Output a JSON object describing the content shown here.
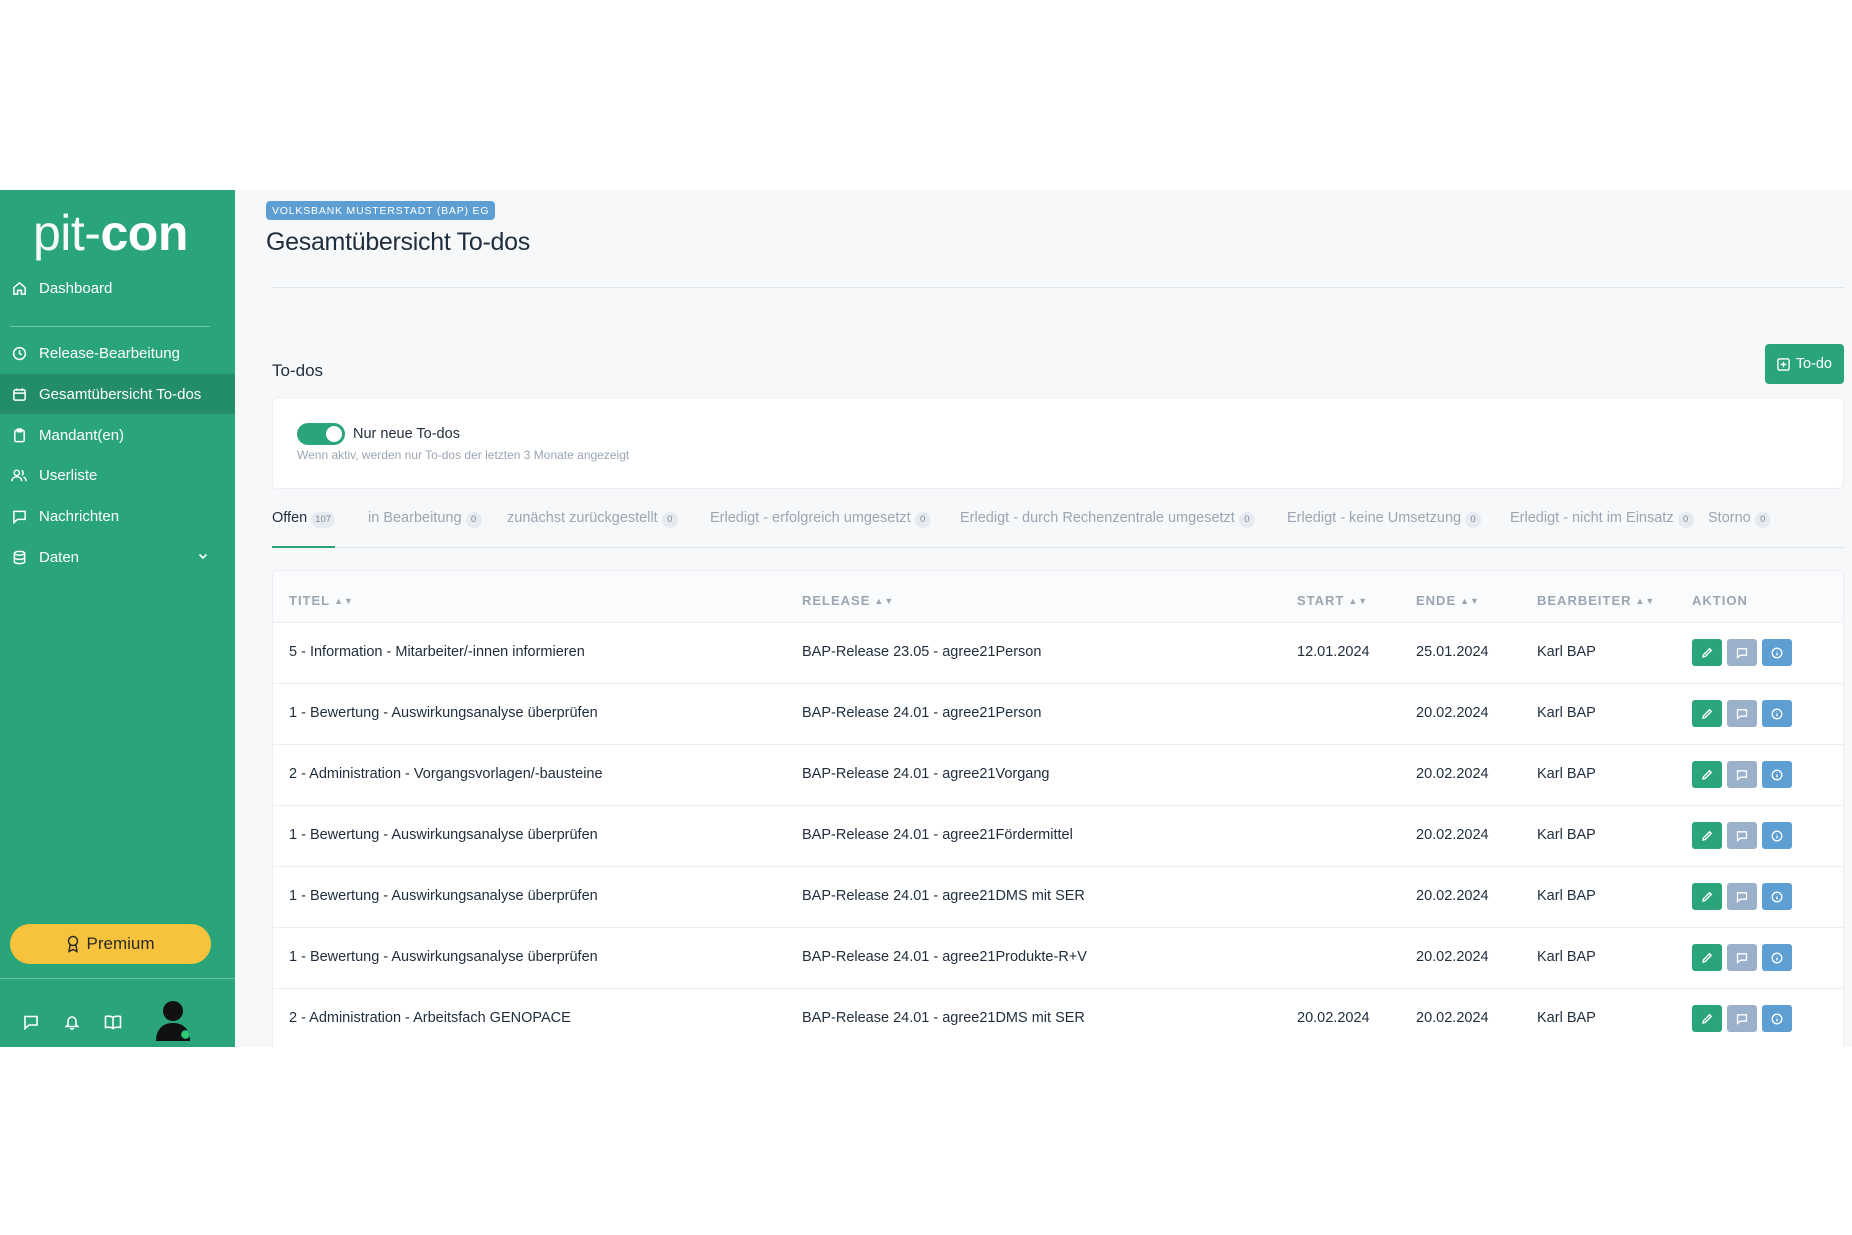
{
  "sidebar": {
    "logo_thin": "pit-",
    "logo_bold": "con",
    "items": [
      {
        "label": "Dashboard",
        "icon": "home-icon"
      },
      {
        "label": "Release-Bearbeitung",
        "icon": "clock-icon"
      },
      {
        "label": "Gesamtübersicht To-dos",
        "icon": "calendar-icon",
        "active": true
      },
      {
        "label": "Mandant(en)",
        "icon": "clipboard-icon"
      },
      {
        "label": "Userliste",
        "icon": "users-icon"
      },
      {
        "label": "Nachrichten",
        "icon": "message-icon"
      },
      {
        "label": "Daten",
        "icon": "database-icon",
        "expandable": true
      }
    ],
    "premium_label": "Premium",
    "bottom_icons": [
      "message-icon",
      "bell-icon",
      "book-icon"
    ]
  },
  "header": {
    "org_badge": "VOLKSBANK MUSTERSTADT (BAP) EG",
    "title": "Gesamtübersicht To-dos"
  },
  "section": {
    "title": "To-dos",
    "add_button_label": "To-do"
  },
  "filter": {
    "toggle_label": "Nur neue To-dos",
    "toggle_on": true,
    "hint": "Wenn aktiv, werden nur To-dos der letzten 3 Monate angezeigt"
  },
  "tabs": [
    {
      "label": "Offen",
      "count": "107",
      "active": true
    },
    {
      "label": "in Bearbeitung",
      "count": "0"
    },
    {
      "label": "zunächst zurückgestellt",
      "count": "0"
    },
    {
      "label": "Erledigt - erfolgreich umgesetzt",
      "count": "0"
    },
    {
      "label": "Erledigt - durch Rechenzentrale umgesetzt",
      "count": "0"
    },
    {
      "label": "Erledigt - keine Umsetzung",
      "count": "0"
    },
    {
      "label": "Erledigt - nicht im Einsatz",
      "count": "0"
    },
    {
      "label": "Storno",
      "count": "0"
    }
  ],
  "table": {
    "columns": [
      "TITEL",
      "RELEASE",
      "START",
      "ENDE",
      "BEARBEITER",
      "AKTION"
    ],
    "rows": [
      {
        "titel": "5 - Information - Mitarbeiter/-innen informieren",
        "release": "BAP-Release 23.05 - agree21Person",
        "start": "12.01.2024",
        "ende": "25.01.2024",
        "bearbeiter": "Karl BAP"
      },
      {
        "titel": "1 - Bewertung - Auswirkungsanalyse überprüfen",
        "release": "BAP-Release 24.01 - agree21Person",
        "start": "",
        "ende": "20.02.2024",
        "bearbeiter": "Karl BAP"
      },
      {
        "titel": "2 - Administration - Vorgangsvorlagen/-bausteine",
        "release": "BAP-Release 24.01 - agree21Vorgang",
        "start": "",
        "ende": "20.02.2024",
        "bearbeiter": "Karl BAP"
      },
      {
        "titel": "1 - Bewertung - Auswirkungsanalyse überprüfen",
        "release": "BAP-Release 24.01 - agree21Fördermittel",
        "start": "",
        "ende": "20.02.2024",
        "bearbeiter": "Karl BAP"
      },
      {
        "titel": "1 - Bewertung - Auswirkungsanalyse überprüfen",
        "release": "BAP-Release 24.01 - agree21DMS mit SER",
        "start": "",
        "ende": "20.02.2024",
        "bearbeiter": "Karl BAP"
      },
      {
        "titel": "1 - Bewertung - Auswirkungsanalyse überprüfen",
        "release": "BAP-Release 24.01 - agree21Produkte-R+V",
        "start": "",
        "ende": "20.02.2024",
        "bearbeiter": "Karl BAP"
      },
      {
        "titel": "2 - Administration - Arbeitsfach GENOPACE",
        "release": "BAP-Release 24.01 - agree21DMS mit SER",
        "start": "20.02.2024",
        "ende": "20.02.2024",
        "bearbeiter": "Karl BAP"
      }
    ]
  },
  "colors": {
    "brand_green": "#2aa57a",
    "active_nav": "#238c68",
    "premium_yellow": "#f8c33c",
    "info_blue": "#5e9fd3",
    "message_gray_blue": "#9bb0ca"
  }
}
